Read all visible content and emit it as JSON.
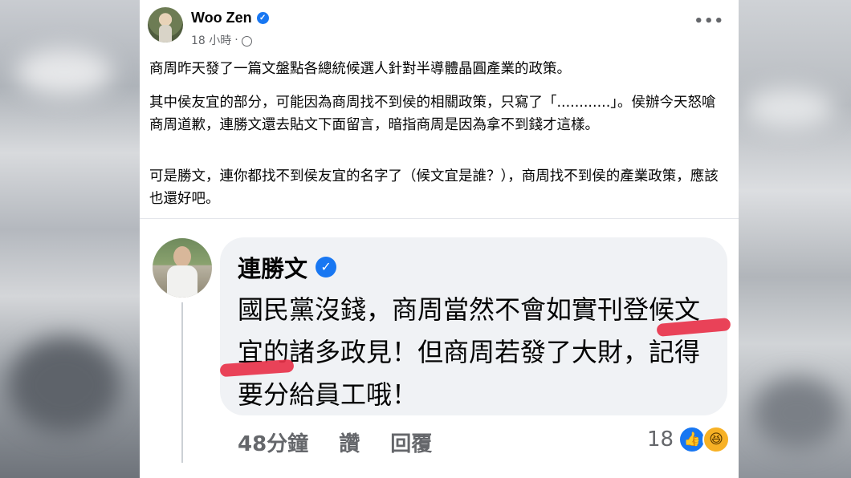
{
  "post": {
    "author": "Woo Zen",
    "time": "18 小時",
    "more": "•••",
    "paragraphs": [
      "商周昨天發了一篇文盤點各總統候選人針對半導體晶圓產業的政策。",
      "其中侯友宜的部分，可能因為商周找不到侯的相關政策，只寫了「............」。侯辦今天怒嗆商周道歉，連勝文還去貼文下面留言，暗指商周是因為拿不到錢才這樣。",
      "可是勝文，連你都找不到侯友宜的名字了（候文宜是誰？），商周找不到侯的產業政策，應該也還好吧。"
    ]
  },
  "comment": {
    "author": "連勝文",
    "text": "國民黨沒錢，商周當然不會如實刊登候文宜的諸多政見！但商周若發了大財，記得要分給員工哦！",
    "time": "48分鐘",
    "like_label": "讚",
    "reply_label": "回覆",
    "reaction_count": "18",
    "reaction_icons": [
      "like-icon",
      "haha-icon"
    ]
  },
  "colors": {
    "accent": "#1877f2",
    "highlight_mark": "#e8334a",
    "meta_text": "#65676b",
    "bubble_bg": "#f0f2f5"
  }
}
